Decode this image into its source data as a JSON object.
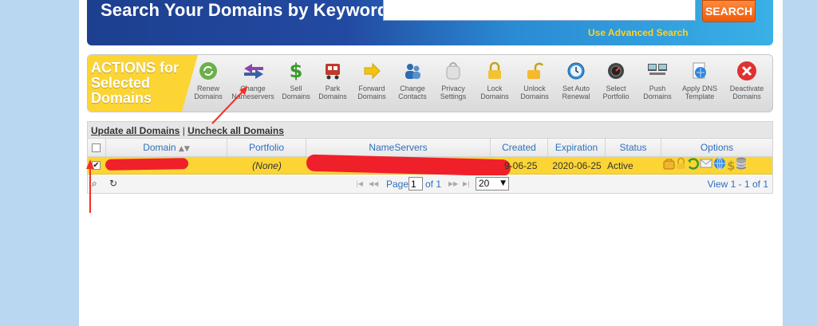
{
  "search": {
    "title": "Search Your Domains by Keyword",
    "input_value": "",
    "button_label": "SEARCH",
    "advanced_link": "Use Advanced Search"
  },
  "actions": {
    "label_lines": [
      "ACTIONS for",
      "Selected",
      "Domains"
    ],
    "items": [
      {
        "label": "Renew\nDomains",
        "icon": "renew-icon"
      },
      {
        "label": "Change\nNameservers",
        "icon": "change-nameservers-icon"
      },
      {
        "label": "Sell\nDomains",
        "icon": "dollar-icon"
      },
      {
        "label": "Park\nDomains",
        "icon": "park-icon"
      },
      {
        "label": "Forward\nDomains",
        "icon": "forward-arrow-icon"
      },
      {
        "label": "Change\nContacts",
        "icon": "contacts-icon"
      },
      {
        "label": "Privacy\nSettings",
        "icon": "privacy-icon"
      },
      {
        "label": "Lock\nDomains",
        "icon": "lock-icon"
      },
      {
        "label": "Unlock\nDomains",
        "icon": "unlock-icon"
      },
      {
        "label": "Set Auto\nRenewal",
        "icon": "auto-renew-clock-icon"
      },
      {
        "label": "Select\nPortfolio",
        "icon": "portfolio-icon"
      },
      {
        "label": "Push\nDomains",
        "icon": "push-icon"
      },
      {
        "label": "Apply DNS\nTemplate",
        "icon": "dns-template-icon"
      },
      {
        "label": "Deactivate\nDomains",
        "icon": "deactivate-icon"
      }
    ]
  },
  "grid": {
    "update_all": "Update all Domains",
    "separator": "|",
    "uncheck_all": "Uncheck all Domains",
    "columns": {
      "domain": "Domain",
      "portfolio": "Portfolio",
      "nameservers": "NameServers",
      "created": "Created",
      "expiration": "Expiration",
      "status": "Status",
      "options": "Options"
    },
    "row": {
      "portfolio": "(None)",
      "created_visible": "9-06-25",
      "expiration": "2020-06-25",
      "status": "Active"
    },
    "pager": {
      "page_label": "Page",
      "page_value": "1",
      "of_label": "of 1",
      "page_size": "20",
      "view_text": "View 1 - 1 of 1"
    }
  },
  "colors": {
    "banner_blue": "#1d3f8f",
    "accent_yellow": "#fcd535",
    "search_orange": "#ee5a0a",
    "link_blue": "#2f6fbf",
    "redaction_red": "#f0202a"
  }
}
